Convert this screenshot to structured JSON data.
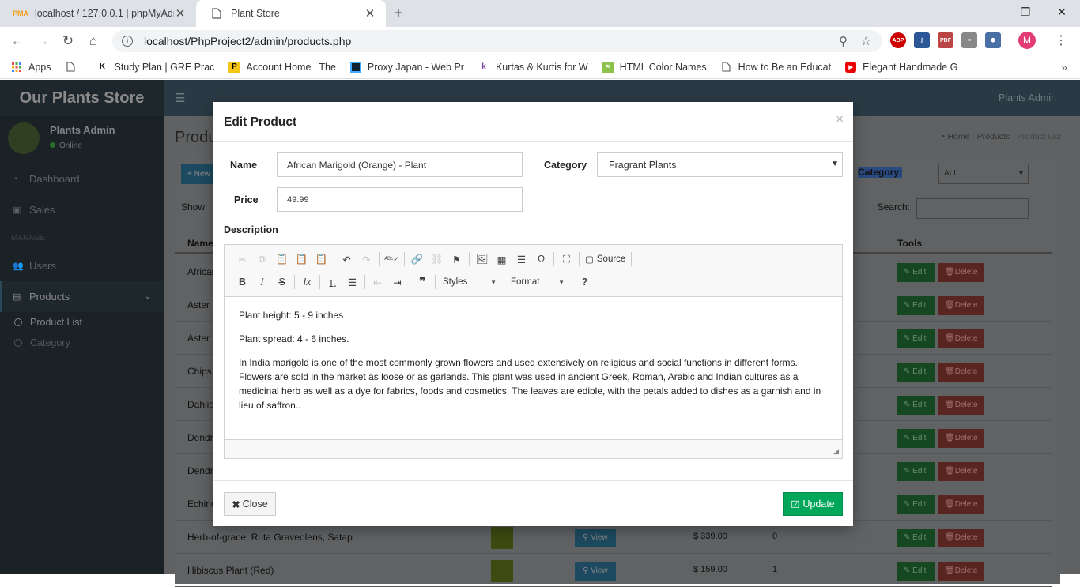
{
  "browser": {
    "tabs": [
      {
        "title": "localhost / 127.0.0.1 | phpMyAdmin",
        "icon": "phpmyadmin-icon",
        "active": false
      },
      {
        "title": "Plant Store",
        "icon": "page-icon",
        "active": true
      }
    ],
    "url": "localhost/PhpProject2/admin/products.php",
    "profile_initial": "M",
    "bookmarks": [
      {
        "label": "Apps",
        "icon": "apps-grid-icon"
      },
      {
        "label": "",
        "icon": "page-icon"
      },
      {
        "label": "Study Plan | GRE Prac",
        "icon": "k-logo-icon"
      },
      {
        "label": "Account Home | The",
        "icon": "p-logo-icon"
      },
      {
        "label": "Proxy Japan - Web Pr",
        "icon": "proxy-icon"
      },
      {
        "label": "Kurtas & Kurtis for W",
        "icon": "k-purple-icon"
      },
      {
        "label": "HTML Color Names",
        "icon": "colornames-icon"
      },
      {
        "label": "How to Be an Educat",
        "icon": "page-icon"
      },
      {
        "label": "Elegant Handmade G",
        "icon": "youtube-icon"
      }
    ]
  },
  "sidebar": {
    "brand": "Our Plants Store",
    "user_name": "Plants Admin",
    "user_status": "Online",
    "items": [
      {
        "label": "Dashboard"
      },
      {
        "label": "Sales"
      }
    ],
    "section_header": "MANAGE",
    "manage_items": [
      {
        "label": "Users"
      },
      {
        "label": "Products"
      }
    ],
    "sub_items": [
      {
        "label": "Product List"
      },
      {
        "label": "Category"
      }
    ]
  },
  "topbar": {
    "user": "Plants Admin"
  },
  "page": {
    "title": "Produ",
    "breadcrumb": [
      "Home",
      "Products",
      "Product List"
    ],
    "new_button": "New",
    "category_label": "Category:",
    "category_value": "ALL",
    "show_label": "Show",
    "search_label": "Search:",
    "col_name": "Name",
    "col_tools": "Tools",
    "edit_label": "Edit",
    "delete_label": "Delete",
    "view_label": "View",
    "rows": [
      {
        "name": "Africar",
        "price": "",
        "qty": ""
      },
      {
        "name": "Aster P",
        "price": "",
        "qty": ""
      },
      {
        "name": "Aster P",
        "price": "",
        "qty": ""
      },
      {
        "name": "Chips",
        "price": "",
        "qty": ""
      },
      {
        "name": "Dahlia",
        "price": "",
        "qty": ""
      },
      {
        "name": "Dendr",
        "price": "",
        "qty": ""
      },
      {
        "name": "Dendr",
        "price": "",
        "qty": ""
      },
      {
        "name": "Echino",
        "price": "",
        "qty": ""
      },
      {
        "name": "Herb-of-grace, Ruta Graveolens, Satap",
        "price": "$ 339.00",
        "qty": "0"
      },
      {
        "name": "Hibiscus Plant (Red)",
        "price": "$ 159.00",
        "qty": "1"
      }
    ]
  },
  "modal": {
    "title": "Edit Product",
    "name_label": "Name",
    "name_value": "African Marigold (Orange) - Plant",
    "category_label": "Category",
    "category_value": "Fragrant Plants",
    "price_label": "Price",
    "price_value": "49.99",
    "description_label": "Description",
    "toolbar": {
      "source_label": "Source",
      "styles_label": "Styles",
      "format_label": "Format"
    },
    "description": {
      "p1": "Plant height: 5 - 9 inches",
      "p2": "Plant spread: 4 - 6 inches.",
      "p3": "In India marigold is one of the most commonly grown flowers and used extensively on religious and social functions in different forms. Flowers are sold in the market as loose or as garlands. This plant was used in ancient Greek, Roman, Arabic and Indian cultures as a medicinal herb as well as a dye for fabrics, foods and cosmetics. The leaves are edible, with the petals added to dishes as a garnish and in lieu of saffron.."
    },
    "close_label": "Close",
    "update_label": "Update"
  },
  "colors": {
    "update_green": "#00a65a",
    "sidebar_bg": "#1a2226",
    "overlay": "#5f6163"
  }
}
